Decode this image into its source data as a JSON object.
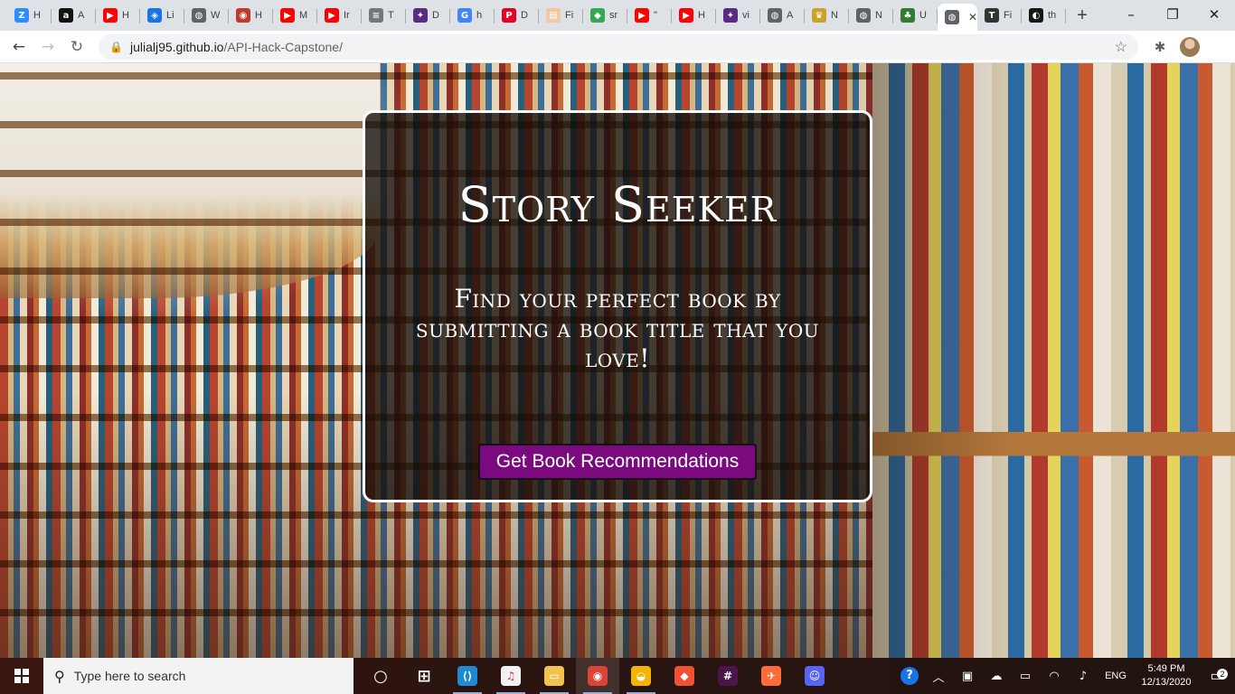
{
  "browser": {
    "tabs": [
      {
        "label": "H",
        "icon": "zoom-icon",
        "color": "#2d8cff",
        "glyph": "Z"
      },
      {
        "label": "A",
        "icon": "amazon-icon",
        "color": "#111111",
        "glyph": "a"
      },
      {
        "label": "H",
        "icon": "youtube-icon",
        "color": "#ff0000",
        "glyph": "▶"
      },
      {
        "label": "Li",
        "icon": "map-pin-icon",
        "color": "#1a73e8",
        "glyph": "◈"
      },
      {
        "label": "W",
        "icon": "globe-icon",
        "color": "#5f6368",
        "glyph": "◍"
      },
      {
        "label": "H",
        "icon": "swirl-icon",
        "color": "#c0392b",
        "glyph": "◉"
      },
      {
        "label": "M",
        "icon": "youtube-icon",
        "color": "#ff0000",
        "glyph": "▶"
      },
      {
        "label": "Ir",
        "icon": "youtube-icon",
        "color": "#ff0000",
        "glyph": "▶"
      },
      {
        "label": "T",
        "icon": "page-icon",
        "color": "#777777",
        "glyph": "≡"
      },
      {
        "label": "D",
        "icon": "figure-icon",
        "color": "#5b2b82",
        "glyph": "✦"
      },
      {
        "label": "h",
        "icon": "google-icon",
        "color": "#4285f4",
        "glyph": "G"
      },
      {
        "label": "D",
        "icon": "pinterest-icon",
        "color": "#e60023",
        "glyph": "P"
      },
      {
        "label": "Fi",
        "icon": "doc-icon",
        "color": "#f4c7a3",
        "glyph": "▤"
      },
      {
        "label": "sr",
        "icon": "maps-icon",
        "color": "#34a853",
        "glyph": "◆"
      },
      {
        "label": "\"",
        "icon": "youtube-icon",
        "color": "#ff0000",
        "glyph": "▶"
      },
      {
        "label": "H",
        "icon": "youtube-icon",
        "color": "#ff0000",
        "glyph": "▶"
      },
      {
        "label": "vi",
        "icon": "figure-icon",
        "color": "#5b2b82",
        "glyph": "✦"
      },
      {
        "label": "A",
        "icon": "globe-icon",
        "color": "#5f6368",
        "glyph": "◍"
      },
      {
        "label": "N",
        "icon": "crown-icon",
        "color": "#c9a227",
        "glyph": "♛"
      },
      {
        "label": "N",
        "icon": "globe-icon",
        "color": "#5f6368",
        "glyph": "◍"
      },
      {
        "label": "U",
        "icon": "tree-icon",
        "color": "#2e7d32",
        "glyph": "♣"
      },
      {
        "label": "",
        "icon": "globe-icon",
        "color": "#5f6368",
        "glyph": "◍",
        "active": true
      },
      {
        "label": "Fi",
        "icon": "type-icon",
        "color": "#333333",
        "glyph": "T"
      },
      {
        "label": "th",
        "icon": "github-icon",
        "color": "#181717",
        "glyph": "◐"
      }
    ],
    "new_tab": "+",
    "url_host": "julialj95.github.io",
    "url_path": "/API-Hack-Capstone/"
  },
  "page": {
    "title": "Story Seeker",
    "subtitle": "Find your perfect book by submitting a book title that you love!",
    "cta_label": "Get Book Recommendations"
  },
  "taskbar": {
    "search_placeholder": "Type here to search",
    "apps": [
      {
        "name": "task-view",
        "color": "#444444",
        "glyph": "○"
      },
      {
        "name": "task-switcher",
        "color": "#444444",
        "glyph": "⊞"
      },
      {
        "name": "vscode",
        "color": "#1f8ad2",
        "glyph": "⟨⟩"
      },
      {
        "name": "itunes",
        "color": "#f2f2f2",
        "glyph": "♫"
      },
      {
        "name": "file-explorer",
        "color": "#f2c14e",
        "glyph": "▭"
      },
      {
        "name": "chrome",
        "color": "#db4437",
        "glyph": "◉"
      },
      {
        "name": "photos",
        "color": "#f4b400",
        "glyph": "◒"
      },
      {
        "name": "git",
        "color": "#f05133",
        "glyph": "◆"
      },
      {
        "name": "slack",
        "color": "#4a154b",
        "glyph": "#"
      },
      {
        "name": "postman",
        "color": "#ff6c37",
        "glyph": "✈"
      },
      {
        "name": "discord",
        "color": "#5865f2",
        "glyph": "☺"
      }
    ],
    "lang": "ENG",
    "time": "5:49 PM",
    "date": "12/13/2020",
    "notification_count": "2"
  }
}
